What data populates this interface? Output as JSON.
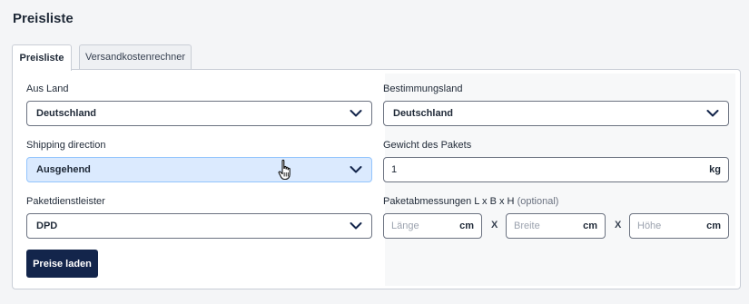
{
  "page": {
    "title": "Preisliste"
  },
  "tabs": [
    {
      "label": "Preisliste",
      "active": true
    },
    {
      "label": "Versandkostenrechner",
      "active": false
    }
  ],
  "form": {
    "origin": {
      "label": "Aus Land",
      "value": "Deutschland"
    },
    "destination": {
      "label": "Bestimmungsland",
      "value": "Deutschland"
    },
    "direction": {
      "label": "Shipping direction",
      "value": "Ausgehend"
    },
    "weight": {
      "label": "Gewicht des Pakets",
      "value": "1",
      "unit": "kg"
    },
    "carrier": {
      "label": "Paketdienstleister",
      "value": "DPD"
    },
    "dimensions": {
      "label": "Paketabmessungen L x B x H",
      "optional": "(optional)",
      "length": {
        "placeholder": "Länge",
        "unit": "cm"
      },
      "width": {
        "placeholder": "Breite",
        "unit": "cm"
      },
      "height": {
        "placeholder": "Höhe",
        "unit": "cm"
      },
      "separator": "X"
    }
  },
  "actions": {
    "load_prices": "Preise laden"
  },
  "colors": {
    "primary_button": "#13254b",
    "highlight": "#dbeafe"
  },
  "icons": {
    "dropdown": "chevron-down-icon",
    "cursor": "hand-pointer-icon"
  }
}
